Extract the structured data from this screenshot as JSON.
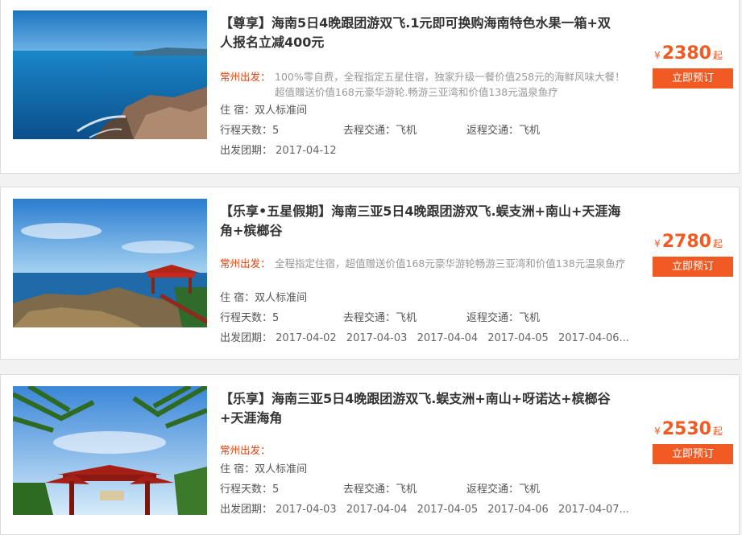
{
  "labels": {
    "accommodation": "住 宿：",
    "days": "行程天数：",
    "go_transport": "去程交通：",
    "return_transport": "返程交通：",
    "departure_dates": "出发团期：",
    "book_button": "立即预订",
    "currency": "¥",
    "price_unit": "起"
  },
  "products": [
    {
      "image_icon": "coastal-rocks-photo",
      "title": "【尊享】海南5日4晚跟团游双飞.1元即可换购海南特色水果一箱+双人报名立减400元",
      "city": "常州出发：",
      "desc": "100%零自费，全程指定五星住宿，独家升级一餐价值258元的海鲜风味大餐！超值赠送价值168元豪华游轮.畅游三亚湾和价值138元温泉鱼疗",
      "accommodation": "双人标准间",
      "days": "5",
      "go_transport": "飞机",
      "return_transport": "飞机",
      "dates": [
        "2017-04-12"
      ],
      "price": "2380"
    },
    {
      "image_icon": "seaside-pavilion-photo",
      "title": "【乐享•五星假期】海南三亚5日4晚跟团游双飞.蜈支洲+南山+天涯海角+槟榔谷",
      "city": "常州出发：",
      "desc": "全程指定住宿，超值赠送价值168元豪华游轮畅游三亚湾和价值138元温泉鱼疗",
      "accommodation": "双人标准间",
      "days": "5",
      "go_transport": "飞机",
      "return_transport": "飞机",
      "dates": [
        "2017-04-02",
        "2017-04-03",
        "2017-04-04",
        "2017-04-05",
        "2017-04-06..."
      ],
      "price": "2780"
    },
    {
      "image_icon": "palm-gate-photo",
      "title": "【乐享】海南三亚5日4晚跟团游双飞.蜈支洲+南山+呀诺达+槟榔谷+天涯海角",
      "city": "常州出发：",
      "desc": "",
      "accommodation": "双人标准间",
      "days": "5",
      "go_transport": "飞机",
      "return_transport": "飞机",
      "dates": [
        "2017-04-03",
        "2017-04-04",
        "2017-04-05",
        "2017-04-06",
        "2017-04-07..."
      ],
      "price": "2530"
    }
  ]
}
